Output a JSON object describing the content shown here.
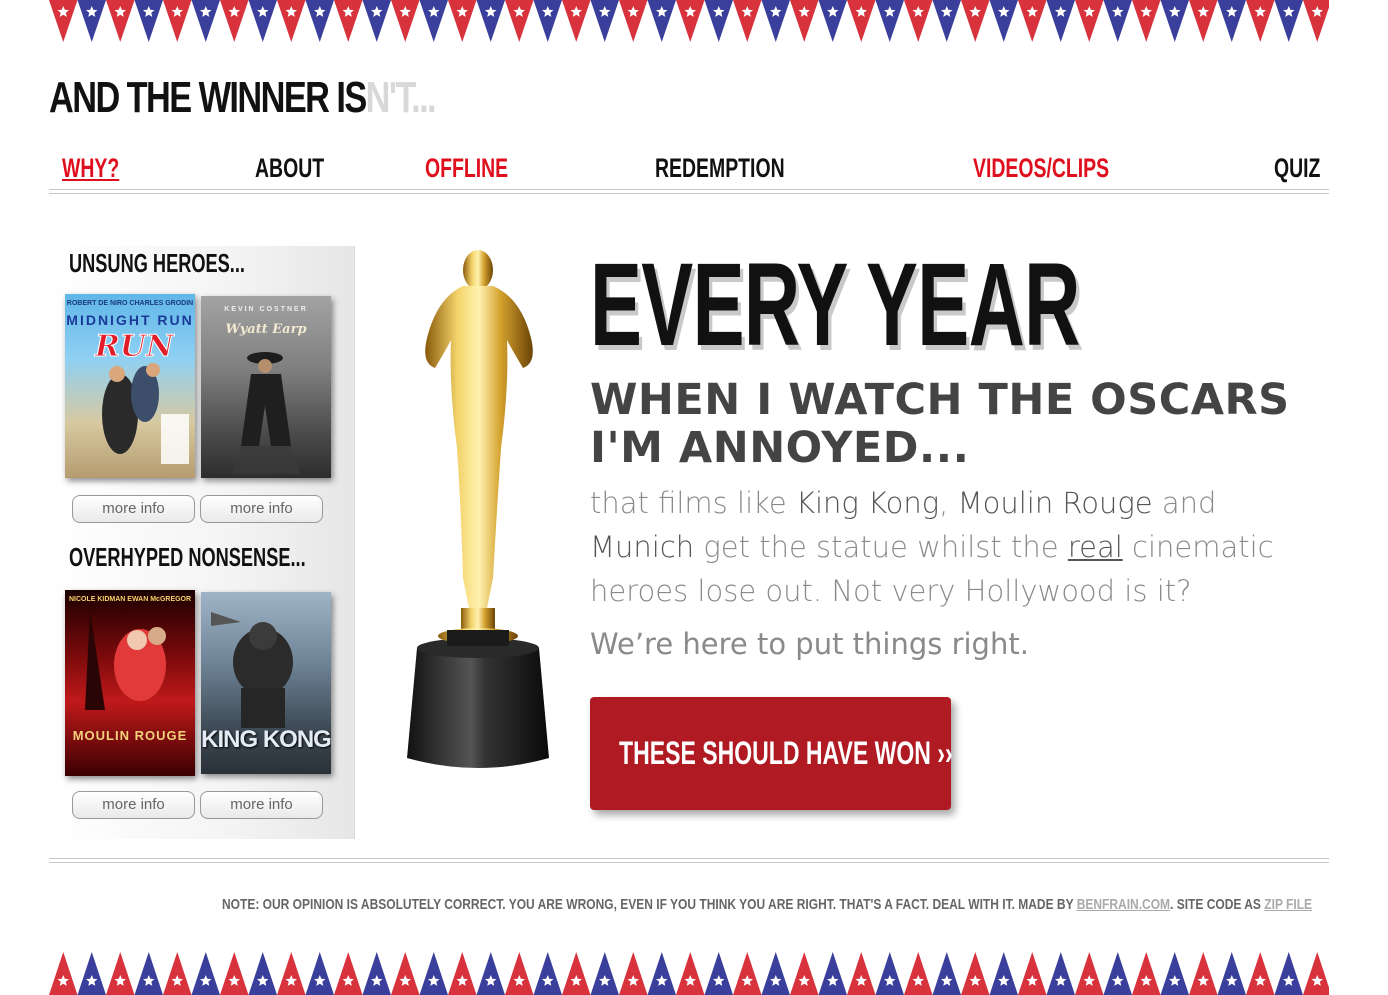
{
  "site": {
    "title_main": "AND THE WINNER IS",
    "title_faded": "N'T..."
  },
  "colors": {
    "accent_red": "#e00f1e",
    "button_red": "#b01a22",
    "bunting_red": "#d8323d",
    "bunting_blue": "#3a3f9c"
  },
  "nav": {
    "items": [
      {
        "label": "WHY?",
        "color": "red",
        "active": true
      },
      {
        "label": "ABOUT",
        "color": "black"
      },
      {
        "label": "OFFLINE",
        "color": "red"
      },
      {
        "label": "REDEMPTION",
        "color": "black"
      },
      {
        "label": "VIDEOS/CLIPS",
        "color": "red"
      },
      {
        "label": "QUIZ",
        "color": "black"
      }
    ]
  },
  "sidebar": {
    "section1_heading": "UNSUNG HEROES...",
    "section2_heading": "OVERHYPED NONSENSE...",
    "posters": [
      {
        "title": "MIDNIGHT RUN",
        "credits": "ROBERT DE NIRO   CHARLES GRODIN"
      },
      {
        "title": "Wyatt Earp",
        "credits": "KEVIN COSTNER"
      },
      {
        "title": "MOULIN ROUGE",
        "credits": "NICOLE KIDMAN   EWAN McGREGOR"
      },
      {
        "title": "KING KONG",
        "credits": ""
      }
    ],
    "more_info_label": "more info"
  },
  "hero": {
    "heading": "EVERY YEAR",
    "subheading": "WHEN I WATCH THE OSCARS I'M ANNOYED...",
    "body_p1": "that films like ",
    "film1": "King Kong",
    "body_p2": ", ",
    "film2": "Moulin Rouge",
    "body_p3": " and ",
    "film3": "Munich",
    "body_p4": " get the statue whilst the ",
    "real_word": "real",
    "body_p5": " cinematic heroes lose out. Not very Hollywood is it?",
    "body2": "We’re here to put things right.",
    "cta_label": "THESE SHOULD HAVE WON ››"
  },
  "footer": {
    "note": "NOTE: OUR OPINION IS ABSOLUTELY CORRECT. YOU ARE WRONG, EVEN IF YOU THINK YOU ARE RIGHT. THAT'S A FACT. DEAL WITH IT. MADE BY ",
    "link1": "BENFRAIN.COM",
    "mid": ". SITE CODE AS ",
    "link2": "ZIP FILE"
  }
}
